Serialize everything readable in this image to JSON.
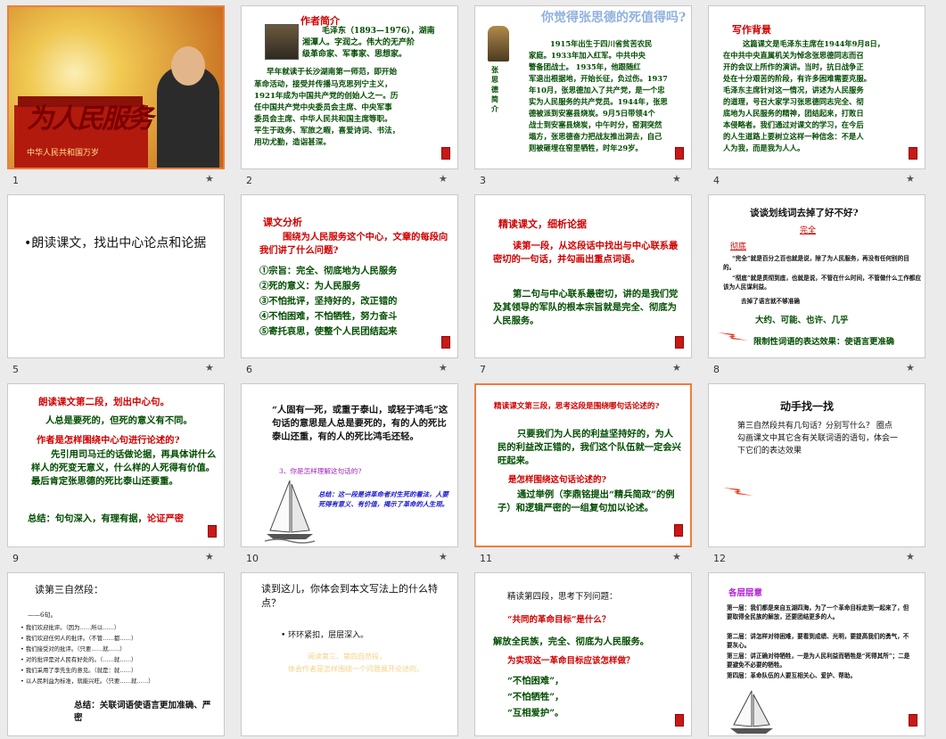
{
  "slides": [
    {
      "num": "1",
      "title_art": "为人民服务",
      "banner_text": "中华人民共和国万岁"
    },
    {
      "num": "2",
      "heading": "作者简介",
      "lines": [
        "毛泽东（1893—1976），湖南",
        "湘潭人。字润之。伟大的无产阶",
        "级革命家、军事家、思想家。",
        "早年就读于长沙湖南第一师范，即开始",
        "革命活动，接受并传播马克思列宁主义，",
        "1921年成为中国共产党的创始人之一。历",
        "任中国共产党中央委员会主席、中央军事",
        "委员会主席、中华人民共和国主席等职。",
        "平生于政务、军旅之暇，喜爱诗词、书法，",
        "用功尤勤，造诣甚深。"
      ]
    },
    {
      "num": "3",
      "heading": "你觉得张思德的死值得吗?",
      "side": "张思德简介",
      "lines": [
        "1915年出生于四川省贫苦农民",
        "家庭。1933年加入红军。中共中央",
        "警备团战士。 1935年，他跟随红",
        "军退出根据地，开始长征，负过伤。1937",
        "年10月，张思德加入了共产党，是一个忠",
        "实为人民服务的共产党员。1944年，张思",
        "德被派到安塞县烧炭。9月5日带领4个",
        "战士到安塞县烧炭，中午时分，窑洞突然",
        "塌方，张思德奋力把战友推出洞去，自己",
        "则被砸埋在窑里牺牲，时年29岁。"
      ]
    },
    {
      "num": "4",
      "heading": "写作背景",
      "lines": [
        "这篇课文是毛泽东主席在1944年9月8日，",
        "在中共中央直属机关为悼念张思德同志而召",
        "开的会议上所作的演讲。当时，抗日战争正",
        "处在十分艰苦的阶段，有许多困难需要克服。",
        "毛泽东主席针对这一情况，讲述为人民服务",
        "的道理，号召大家学习张思德同志完全、彻",
        "底地为人民服务的精神，团结起来，打败日",
        "本侵略者。我们通过对课文的学习，在今后",
        "的人生道路上要树立这样一种信念：不是人",
        "人为我，而是我为人人。"
      ]
    },
    {
      "num": "5",
      "bullet": "•朗读课文，找出中心论点和论据"
    },
    {
      "num": "6",
      "heading": "课文分析",
      "question": "围绕为人民服务这个中心，文章的每段向我们讲了什么问题?",
      "items": [
        "①宗旨：完全、彻底地为人民服务",
        "②死的意义：为人民服务",
        "③不怕批评，坚持好的，改正错的",
        "④不怕困难，不怕牺牲，努力奋斗",
        "⑤寄托哀思，使整个人民团结起来"
      ]
    },
    {
      "num": "7",
      "heading": "精读课文，细析论据",
      "question": "读第一段，从这段话中找出与中心联系最密切的一句话，并勾画出重点词语。",
      "answer": "第二句与中心联系最密切，讲的是我们党及其领导的军队的根本宗旨就是完全、彻底为人民服务。"
    },
    {
      "num": "8",
      "heading": "谈谈划线词去掉了好不好?",
      "word1": "完全",
      "word2": "彻底",
      "def1": "“完全”就是百分之百也就是说，除了为人民服务，再没有任何别的目的。",
      "def2": "“彻底”就是贯彻到底，也就是说，不管在什么时间，不管做什么工作都应该为人民谋利益。",
      "note": "去掉了语言就不够准确",
      "words": "大约、可能、也许、几乎",
      "summary": "限制性词语的表达效果：使语言更准确"
    },
    {
      "num": "9",
      "heading": "朗读课文第二段，划出中心句。",
      "center": "人总是要死的，但死的意义有不同。",
      "question": "作者是怎样围绕中心句进行论述的?",
      "body": "先引用司马迁的话做论据，再具体讲什么样人的死变无意义，什么样的人死得有价值。最后肯定张思德的死比泰山还要重。",
      "summary_label": "总结：句句深入，有理有据，",
      "summary_red": "论证严密"
    },
    {
      "num": "10",
      "quote": "“人固有一死，或重于泰山，或轻于鸿毛”这句话的意思是人总是要死的，有的人的死比泰山还重，有的人的死比鸿毛还轻。",
      "question": "3、你是怎样理解这句话的?",
      "answer": "总结：这一段是讲革命者对生死的看法，人要死得有意义、有价值，揭示了革命的人生观。"
    },
    {
      "num": "11",
      "heading": "精读课文第三段，思考这段是围绕哪句话论述的?",
      "answer1": "只要我们为人民的利益坚持好的，为人民的利益改正错的，我们这个队伍就一定会兴旺起来。",
      "question2": "是怎样围绕这句话论述的?",
      "answer2": "通过举例（李鼎铭提出“精兵简政”的例子）和逻辑严密的一组复句加以论述。"
    },
    {
      "num": "12",
      "heading": "动手找一找",
      "body": "第三自然段共有几句话？分别写什么？ 圈点勾画课文中其它含有关联词语的语句，体会一下它们的表达效果"
    },
    {
      "num": "",
      "heading": "读第三自然段：",
      "sub": "——6句。",
      "items": [
        "我们欢迎批评。（因为……所以……）",
        "我们欢迎任何人的批评。（不管……都……）",
        "我们接受对的批评。（只要……就……）",
        "对的批评是对人民有好处的。（……就……）",
        "我们采用了李先生的意见。（就是：就……）",
        "以人民利益为标准，就能兴旺。（只要……就……）"
      ],
      "summary": "总结：关联词语使语言更加准确、严密"
    },
    {
      "num": "",
      "question": "读到这儿，你体会到本文写法上的什么特点？",
      "answer": "环环紧扣，层层深入。",
      "faint1": "阅读第三、第四自然段，",
      "faint2": "体会作者是怎样围绕一个问题展开论述的。"
    },
    {
      "num": "",
      "heading": "精读第四段，思考下列问题：",
      "q1": "“共同的革命目标”是什么？",
      "a1": "解放全民族，完全、彻底为人民服务。",
      "q2": "为实现这一革命目标应该怎样做？",
      "a2a": "“不怕困难”，",
      "a2b": "“不怕牺牲”，",
      "a2c": "“互相爱护”。"
    },
    {
      "num": "",
      "heading": "各层层意",
      "lines": [
        "第一层：我们都是来自五湖四海，为了一个革命目标走到一起来了，但要取得全民族的解放，还要团结更多的人。",
        "第二层：讲怎样对待困难，要看到成绩、光明，要提高我们的勇气，不要灰心。",
        "第三层：讲正确对待牺牲，一是为人民利益而牺牲是“死得其所”；二是要避免不必要的牺牲。",
        "第四层：革命队伍的人要互相关心、爱护、帮助。"
      ]
    }
  ],
  "star": "★"
}
